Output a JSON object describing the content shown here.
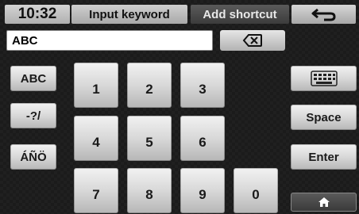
{
  "header": {
    "time": "10:32",
    "title": "Input keyword",
    "add_shortcut": "Add shortcut"
  },
  "input": {
    "value": "ABC"
  },
  "keys": {
    "digits": [
      "1",
      "2",
      "3",
      "4",
      "5",
      "6",
      "7",
      "8",
      "9",
      "0"
    ],
    "abc": "ABC",
    "symbols": "-?/",
    "accents": "ÁÑÖ",
    "space": "Space",
    "enter": "Enter"
  },
  "icons": {
    "back": "back-arrow-icon",
    "backspace": "backspace-icon",
    "keyboard": "keyboard-icon",
    "home": "home-icon"
  }
}
